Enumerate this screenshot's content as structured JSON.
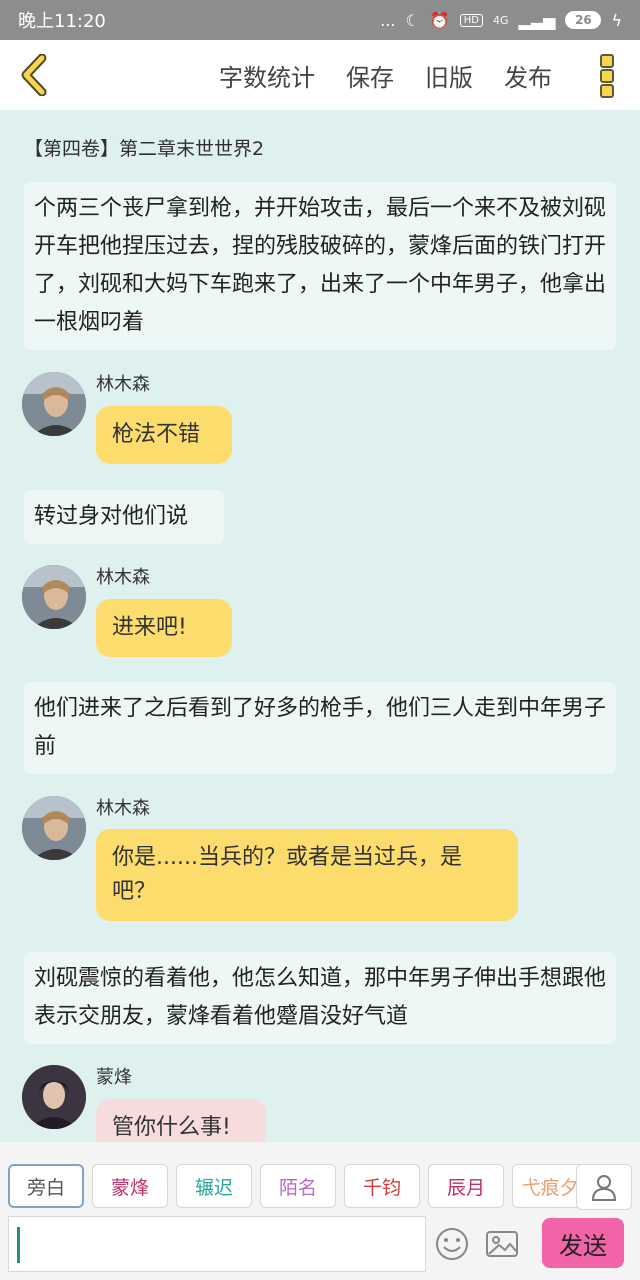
{
  "status_bar": {
    "time": "晚上11:20",
    "dots": "...",
    "hd": "HD",
    "network": "4G",
    "battery": "26"
  },
  "nav": {
    "actions": [
      "字数统计",
      "保存",
      "旧版",
      "发布"
    ]
  },
  "chapter": {
    "title": "【第四卷】第二章末世世界2"
  },
  "messages": [
    {
      "type": "narration",
      "text": "个两三个丧尸拿到枪，并开始攻击，最后一个来不及被刘砚开车把他捏压过去，捏的残肢破碎的，蒙烽后面的铁门打开了，刘砚和大妈下车跑来了，出来了一个中年男子，他拿出一根烟叼着"
    },
    {
      "type": "dialog",
      "name": "林木森",
      "text": "枪法不错"
    },
    {
      "type": "narration",
      "text": "转过身对他们说"
    },
    {
      "type": "dialog",
      "name": "林木森",
      "text": "进来吧!"
    },
    {
      "type": "narration",
      "text": "他们进来了之后看到了好多的枪手，他们三人走到中年男子前"
    },
    {
      "type": "dialog",
      "name": "林木森",
      "text": "你是......当兵的？或者是当过兵，是吧？"
    },
    {
      "type": "narration",
      "text": "刘砚震惊的看着他，他怎么知道，那中年男子伸出手想跟他表示交朋友，蒙烽看着他蹙眉没好气道"
    },
    {
      "type": "dialog",
      "name": "蒙烽",
      "text": "管你什么事!"
    }
  ],
  "roles": [
    {
      "label": "旁白",
      "color": "#555555"
    },
    {
      "label": "蒙烽",
      "color": "#c0306a"
    },
    {
      "label": "辗迟",
      "color": "#2aa7a0"
    },
    {
      "label": "陌名",
      "color": "#b46ad2"
    },
    {
      "label": "千钧",
      "color": "#d23a3a"
    },
    {
      "label": "辰月",
      "color": "#c0306a"
    },
    {
      "label": "弋痕夕",
      "color": "#e8a070"
    }
  ],
  "input": {
    "placeholder": ""
  },
  "send_label": "发送",
  "icons": {
    "back": "chevron-left-icon",
    "menu": "more-vertical-icon",
    "emoji": "smile-icon",
    "image": "image-icon",
    "person": "person-icon"
  }
}
